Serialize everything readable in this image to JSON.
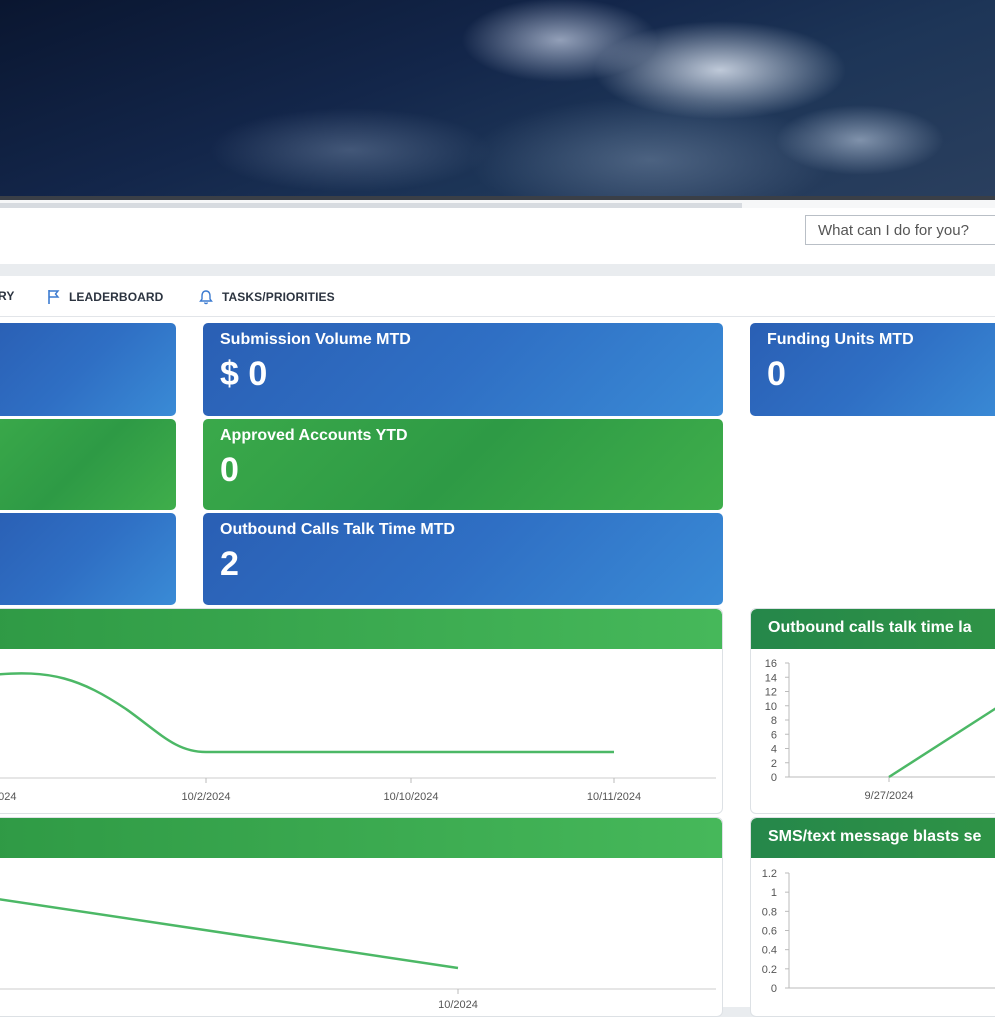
{
  "search": {
    "placeholder": "What can I do for you?"
  },
  "nav": {
    "items": [
      {
        "label": "RY",
        "icon": "none"
      },
      {
        "label": "LEADERBOARD",
        "icon": "flag-icon"
      },
      {
        "label": "TASKS/PRIORITIES",
        "icon": "bell-icon"
      }
    ]
  },
  "cards": [
    {
      "title": "Submission Volume MTD",
      "value": "$ 0",
      "color": "#2f6fc4"
    },
    {
      "title": "Funding Units MTD",
      "value": "0",
      "color": "#2f6fc4"
    },
    {
      "title": "Approved Accounts YTD",
      "value": "0",
      "color": "#34a64a"
    },
    {
      "title": "Outbound Calls Talk Time MTD",
      "value": "2",
      "color": "#2f6fc4"
    }
  ],
  "panels": {
    "outbound_talk": {
      "title": "Outbound calls talk time la"
    },
    "sms_blasts": {
      "title": "SMS/text message blasts se"
    }
  },
  "chart_data": [
    {
      "type": "line",
      "title": "",
      "x": [
        "/2024",
        "10/2/2024",
        "10/10/2024",
        "10/11/2024"
      ],
      "series": [
        {
          "values": [
            14,
            4,
            4,
            4
          ]
        }
      ],
      "color": "#4cb866"
    },
    {
      "type": "line",
      "title": "Outbound calls talk time la",
      "x": [
        "9/27/2024"
      ],
      "yticks": [
        "16",
        "14",
        "12",
        "10",
        "8",
        "6",
        "4",
        "2",
        "0"
      ],
      "ylim": [
        0,
        16
      ],
      "series": [
        {
          "values": [
            0,
            10
          ]
        }
      ],
      "color": "#4cb866"
    },
    {
      "type": "line",
      "title": "",
      "x": [
        "10/2024"
      ],
      "series": [
        {
          "values": [
            1,
            0.3
          ]
        }
      ],
      "color": "#4cb866"
    },
    {
      "type": "line",
      "title": "SMS/text message blasts se",
      "x": [],
      "yticks": [
        "1.2",
        "1",
        "0.8",
        "0.6",
        "0.4",
        "0.2",
        "0"
      ],
      "ylim": [
        0,
        1.2
      ],
      "series": [],
      "color": "#4cb866"
    }
  ]
}
